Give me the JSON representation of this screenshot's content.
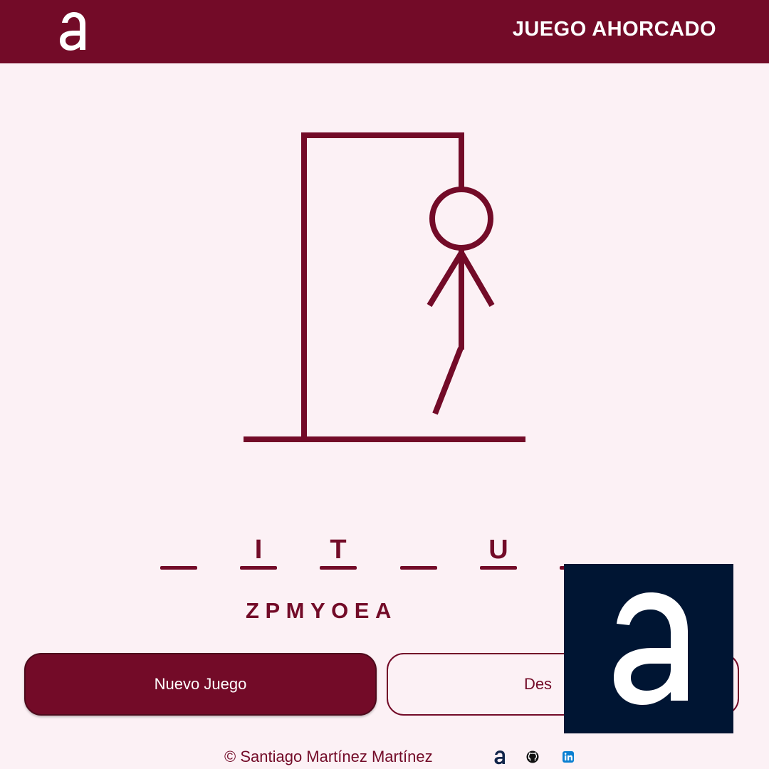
{
  "header": {
    "title": "JUEGO AHORCADO",
    "logo_icon": "a-logo-icon"
  },
  "game": {
    "slots": [
      "",
      "I",
      "T",
      "",
      "U",
      ""
    ],
    "wrong_letters": [
      "Z",
      "P",
      "M",
      "Y",
      "O",
      "E",
      "A"
    ],
    "hangman_parts_shown": [
      "head",
      "body",
      "left-arm",
      "right-arm",
      "left-leg"
    ]
  },
  "buttons": {
    "new_game": "Nuevo Juego",
    "give_up": "Des"
  },
  "footer": {
    "copyright": "© Santiago Martínez Martínez",
    "icons": [
      "a-logo-icon",
      "github-icon",
      "linkedin-icon"
    ]
  },
  "colors": {
    "primary": "#730b28",
    "background": "#fcf1f5",
    "overlay": "#001533"
  }
}
